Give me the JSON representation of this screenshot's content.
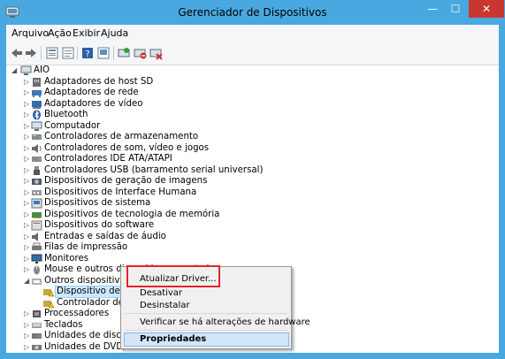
{
  "window": {
    "title": "Gerenciador de Dispositivos",
    "minimize_glyph": "—",
    "maximize_glyph": "☐",
    "close_glyph": "✕"
  },
  "menu": {
    "items": [
      "Arquivo",
      "Ação",
      "Exibir",
      "Ajuda"
    ]
  },
  "toolbar": {
    "icons": [
      "back-icon",
      "forward-icon",
      "properties-icon",
      "details-icon",
      "help-icon",
      "update-driver-icon",
      "scan-hardware-icon",
      "disable-icon",
      "uninstall-icon"
    ]
  },
  "tree": {
    "root": "AIO",
    "items": [
      "Adaptadores de host SD",
      "Adaptadores de rede",
      "Adaptadores de vídeo",
      "Bluetooth",
      "Computador",
      "Controladores de armazenamento",
      "Controladores de som, vídeo e jogos",
      "Controladores IDE ATA/ATAPI",
      "Controladores USB (barramento serial universal)",
      "Dispositivos de geração de imagens",
      "Dispositivos de Interface Humana",
      "Dispositivos de sistema",
      "Dispositivos de tecnologia de memória",
      "Dispositivos do software",
      "Entradas e saídas de áudio",
      "Filas de impressão",
      "Monitores",
      "Mouse e outros dispositivos apontadores",
      "Outros dispositivos"
    ],
    "children": [
      "Dispositivo descon",
      "Controlador de com"
    ],
    "after": [
      "Processadores",
      "Teclados",
      "Unidades de disco",
      "Unidades de DVD/CD-R"
    ]
  },
  "context_menu": {
    "update": "Atualizar Driver...",
    "disable": "Desativar",
    "uninstall": "Desinstalar",
    "scan": "Verificar se há alterações de hardware",
    "properties": "Propriedades"
  },
  "colors": {
    "titlebar": "#4aa8e0",
    "close": "#c7372f",
    "highlight_box": "#e2262d"
  }
}
